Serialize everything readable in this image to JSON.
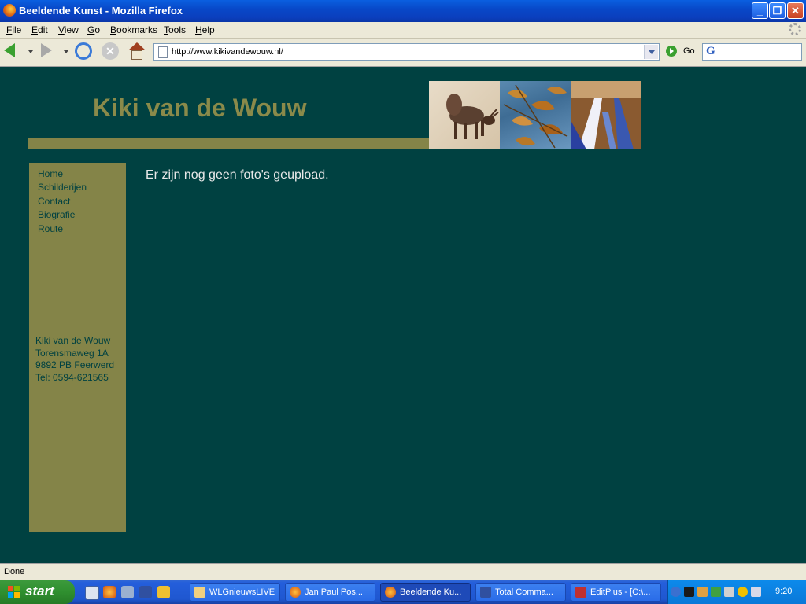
{
  "window": {
    "title": "Beeldende Kunst - Mozilla Firefox"
  },
  "menu": [
    "File",
    "Edit",
    "View",
    "Go",
    "Bookmarks",
    "Tools",
    "Help"
  ],
  "toolbar": {
    "url": "http://www.kikivandewouw.nl/",
    "go_label": "Go",
    "search_engine_glyph": "G"
  },
  "site": {
    "title": "Kiki van de Wouw",
    "nav": [
      "Home",
      "Schilderijen",
      "Contact",
      "Biografie",
      "Route"
    ],
    "address": [
      "Kiki van de Wouw",
      "Torensmaweg 1A",
      "9892 PB Feerwerd",
      "Tel: 0594-621565"
    ],
    "message": "Er zijn nog geen foto's geupload."
  },
  "status": {
    "text": "Done"
  },
  "taskbar": {
    "start_label": "start",
    "tasks": [
      {
        "label": "WLGnieuwsLIVE",
        "icon": "folder-icon"
      },
      {
        "label": "Jan Paul Pos...",
        "icon": "firefox-icon"
      },
      {
        "label": "Beeldende Ku...",
        "icon": "firefox-icon",
        "active": true
      },
      {
        "label": "Total Comma...",
        "icon": "floppy-icon"
      },
      {
        "label": "EditPlus - [C:\\...",
        "icon": "editplus-icon"
      }
    ],
    "clock": "9:20"
  },
  "colors": {
    "page_background": "#004141",
    "accent_olive": "#848448",
    "title_olive": "#8a8a4a"
  }
}
